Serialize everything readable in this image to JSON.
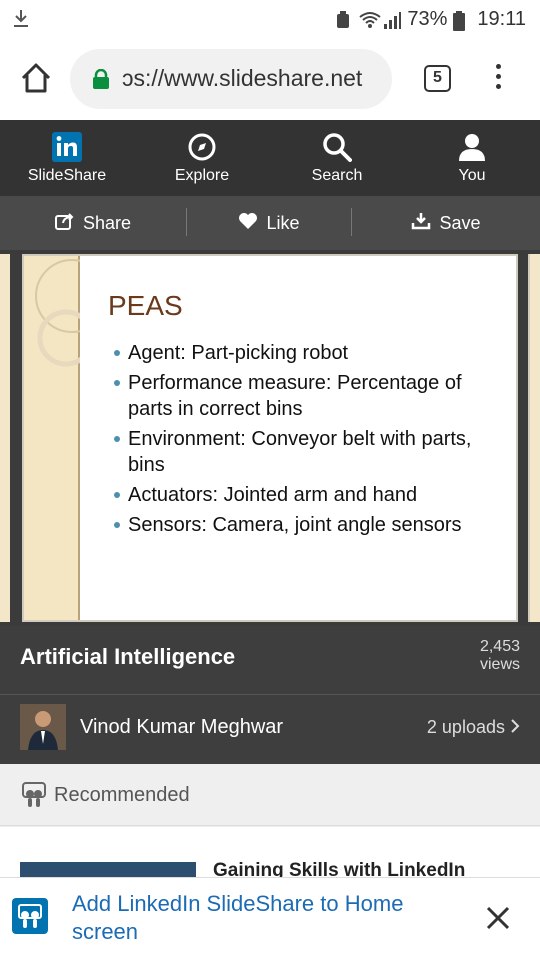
{
  "status_bar": {
    "battery": "73%",
    "time": "19:11"
  },
  "browser": {
    "url": "ɔs://www.slideshare.net",
    "tab_count": "5"
  },
  "nav": {
    "items": [
      {
        "label": "SlideShare",
        "icon": "linkedin-icon"
      },
      {
        "label": "Explore",
        "icon": "compass-icon"
      },
      {
        "label": "Search",
        "icon": "search-icon"
      },
      {
        "label": "You",
        "icon": "user-icon"
      }
    ]
  },
  "actions": {
    "share": "Share",
    "like": "Like",
    "save": "Save"
  },
  "slide": {
    "title": "PEAS",
    "bullets": [
      "Agent: Part-picking robot",
      "Performance measure: Percentage of parts in correct bins",
      "Environment: Conveyor belt with parts, bins",
      "Actuators: Jointed arm and hand",
      "Sensors: Camera, joint angle sensors"
    ]
  },
  "deck": {
    "title": "Artificial Intelligence",
    "views_count": "2,453",
    "views_label": "views",
    "author": "Vinod Kumar Meghwar",
    "uploads": "2 uploads"
  },
  "recommended": {
    "label": "Recommended",
    "first_item_title": "Gaining Skills with LinkedIn"
  },
  "banner": {
    "text": "Add LinkedIn SlideShare to Home screen"
  },
  "colors": {
    "nav_bg": "#333334",
    "action_bg": "#4a4a4b",
    "banner_text": "#1c6bb5",
    "linkedin_blue": "#0073b0",
    "lock_green": "#0a8f3e"
  }
}
